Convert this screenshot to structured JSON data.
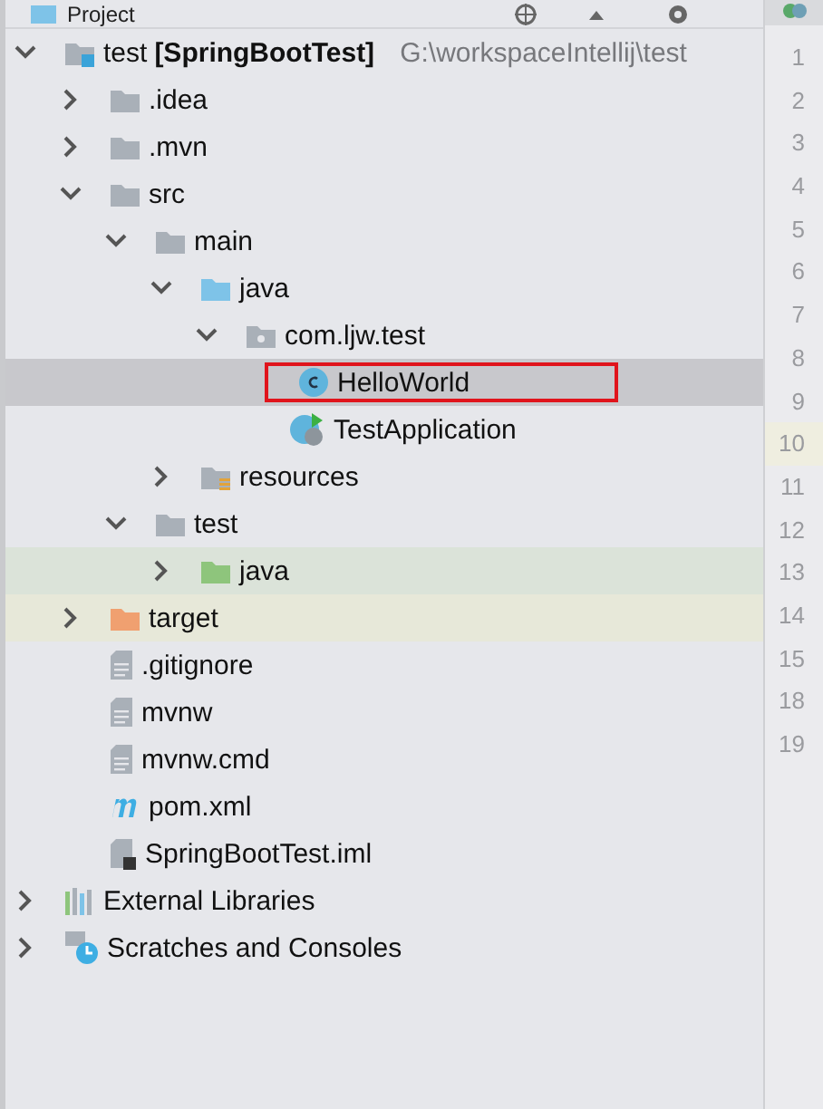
{
  "panel": {
    "title": "Project"
  },
  "tree": [
    {
      "name": "test",
      "module": "[SpringBootTest]",
      "path": "G:\\workspaceIntellij\\test",
      "kind": "module",
      "expanded": true,
      "selected": false,
      "children": [
        {
          "name": ".idea",
          "kind": "folder",
          "expanded": false,
          "selected": false
        },
        {
          "name": ".mvn",
          "kind": "folder",
          "expanded": false,
          "selected": false
        },
        {
          "name": "src",
          "kind": "folder",
          "expanded": true,
          "selected": false,
          "children": [
            {
              "name": "main",
              "kind": "folder",
              "expanded": true,
              "selected": false,
              "children": [
                {
                  "name": "java",
                  "kind": "source",
                  "expanded": true,
                  "selected": false,
                  "children": [
                    {
                      "name": "com.ljw.test",
                      "kind": "package",
                      "expanded": true,
                      "selected": false,
                      "children": [
                        {
                          "name": "HelloWorld",
                          "kind": "class",
                          "selected": true,
                          "outlined": true
                        },
                        {
                          "name": "TestApplication",
                          "kind": "application",
                          "selected": false,
                          "outlined": false
                        }
                      ]
                    }
                  ]
                },
                {
                  "name": "resources",
                  "kind": "resources",
                  "expanded": false,
                  "selected": false
                }
              ]
            },
            {
              "name": "test",
              "kind": "folder",
              "expanded": true,
              "selected": false,
              "children": [
                {
                  "name": "java",
                  "kind": "tests",
                  "expanded": false,
                  "selected": false,
                  "color": "#dbe3d9"
                }
              ]
            }
          ]
        },
        {
          "name": "target",
          "kind": "excluded",
          "expanded": false,
          "selected": false,
          "color": "#e7e8d9"
        },
        {
          "name": ".gitignore",
          "kind": "file",
          "selected": false
        },
        {
          "name": "mvnw",
          "kind": "file",
          "selected": false
        },
        {
          "name": "mvnw.cmd",
          "kind": "file",
          "selected": false
        },
        {
          "name": "pom.xml",
          "kind": "maven",
          "selected": false
        },
        {
          "name": "SpringBootTest.iml",
          "kind": "iml",
          "selected": false
        }
      ]
    },
    {
      "name": "External Libraries",
      "kind": "libraries",
      "expanded": false,
      "selected": false
    },
    {
      "name": "Scratches and Consoles",
      "kind": "scratches",
      "expanded": false,
      "selected": false
    }
  ],
  "gutter": {
    "lines": [
      {
        "number": "1",
        "current": false
      },
      {
        "number": "2",
        "current": false
      },
      {
        "number": "3",
        "current": false
      },
      {
        "number": "4",
        "current": false
      },
      {
        "number": "5",
        "current": false
      },
      {
        "number": "6",
        "current": false
      },
      {
        "number": "7",
        "current": false
      },
      {
        "number": "8",
        "current": false
      },
      {
        "number": "9",
        "current": false
      },
      {
        "number": "10",
        "current": true
      },
      {
        "number": "11",
        "current": false
      },
      {
        "number": "12",
        "current": false
      },
      {
        "number": "13",
        "current": false
      },
      {
        "number": "14",
        "current": false
      },
      {
        "number": "15",
        "current": false
      },
      {
        "number": "18",
        "current": false
      },
      {
        "number": "19",
        "current": false
      }
    ]
  }
}
